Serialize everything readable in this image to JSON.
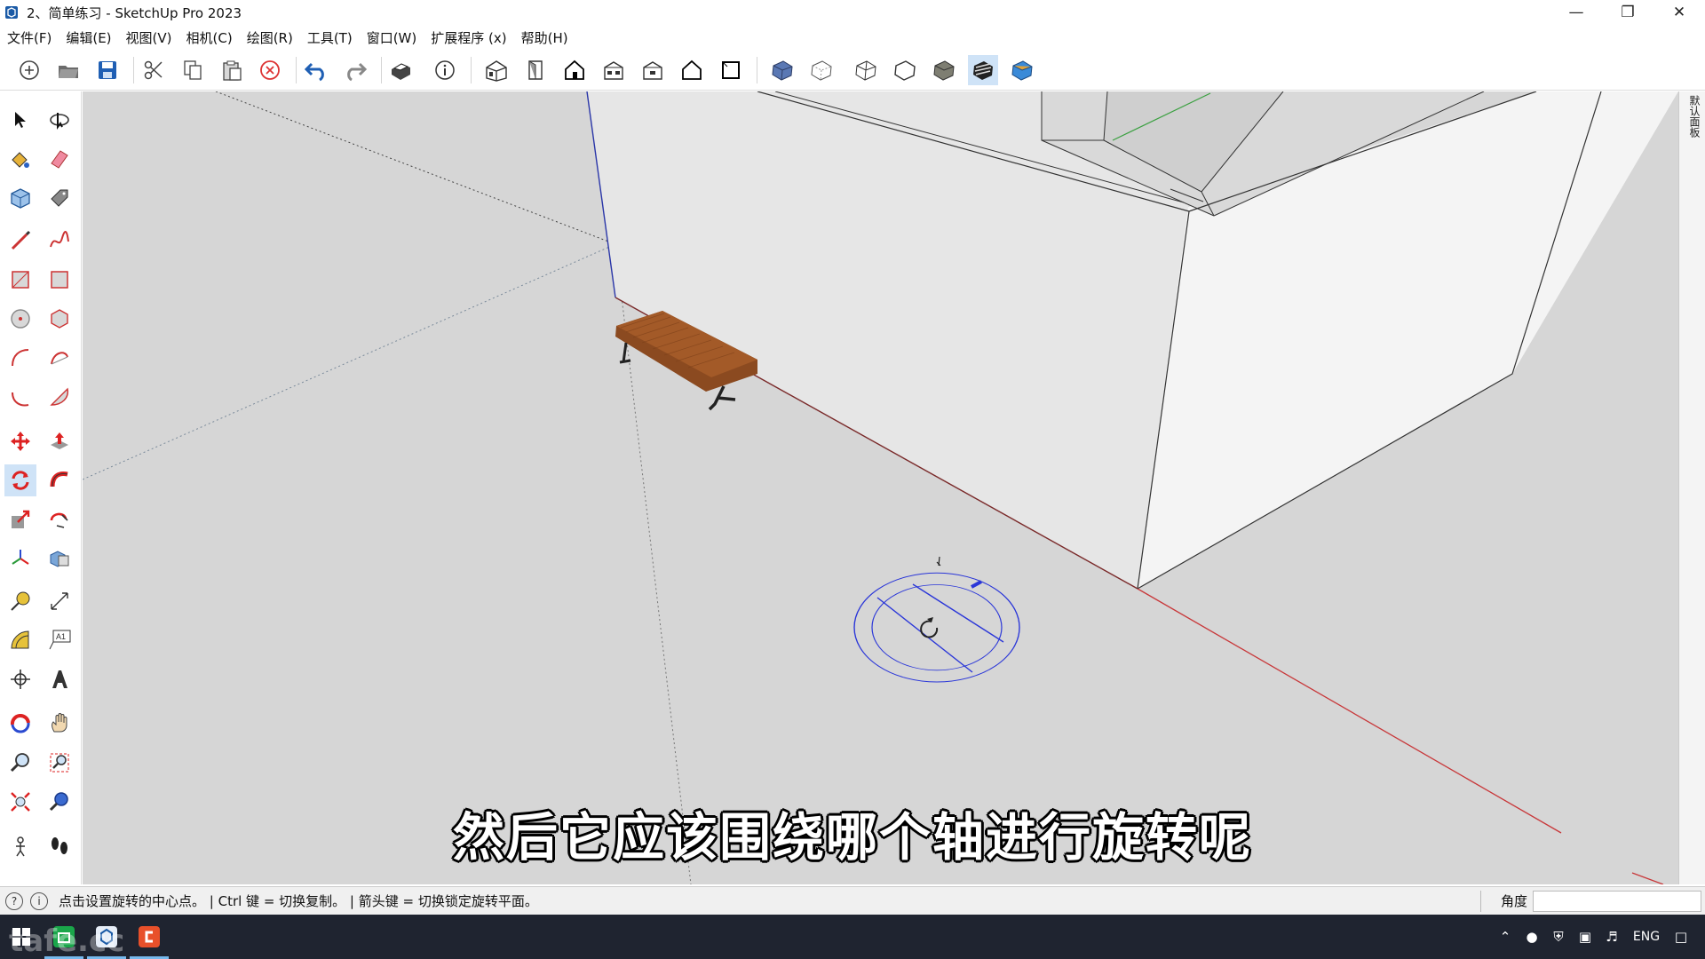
{
  "window": {
    "title": "2、简单练习 - SketchUp Pro 2023",
    "controls": [
      "minimize-icon",
      "restore-icon",
      "close-icon"
    ]
  },
  "menubar": [
    "文件(F)",
    "编辑(E)",
    "视图(V)",
    "相机(C)",
    "绘图(R)",
    "工具(T)",
    "窗口(W)",
    "扩展程序 (x)",
    "帮助(H)"
  ],
  "toolbar": {
    "buttons": [
      "new-icon",
      "open-icon",
      "save-icon",
      "cut-icon",
      "copy-icon",
      "paste-icon",
      "erase-icon",
      "undo-icon",
      "redo-icon",
      "print-icon",
      "model-info-icon",
      "iso-view-icon",
      "top-view-icon",
      "front-view-icon",
      "right-view-icon",
      "back-view-icon",
      "left-view-icon",
      "bottom-view-icon",
      "xray-icon",
      "backedges-icon",
      "wireframe-icon",
      "hiddenline-icon",
      "shaded-icon",
      "shaded-textures-icon",
      "monochrome-icon"
    ],
    "active": "shaded-textures-icon"
  },
  "left_tools": {
    "active": "rotate-tool-icon"
  },
  "subtitle": "然后它应该围绕哪个轴进行旋转呢",
  "right_panel": {
    "tab": "默认面板"
  },
  "statusbar": {
    "message": "点击设置旋转的中心点。 | Ctrl 键 = 切换复制。 | 箭头键 = 切换锁定旋转平面。",
    "measure_label": "角度",
    "measure_value": ""
  },
  "taskbar": {
    "tray_lang": "ENG",
    "watermark": "tafe.cc"
  },
  "colors": {
    "red_axis": "#c8383a",
    "green_axis": "#3aa040",
    "blue_axis": "#3344cc",
    "protractor": "#2a36d8",
    "ground": "#d6d6d6",
    "wall": "#efefef",
    "wood": "#8b4a20"
  }
}
